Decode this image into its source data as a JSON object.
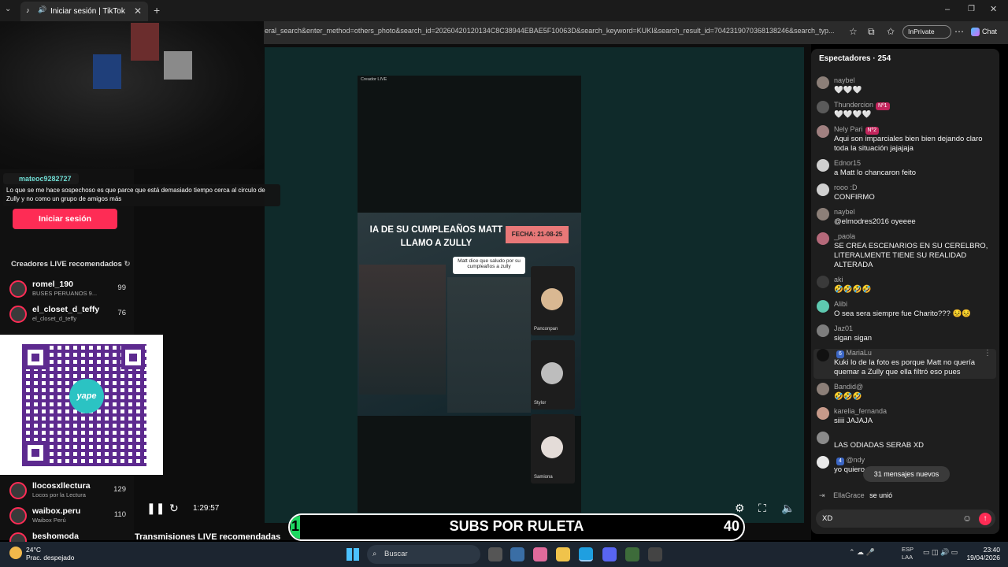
{
  "browser": {
    "tab_title": "Iniciar sesión | TikTok",
    "url": "eral_search&enter_method=others_photo&search_id=20260420120134C8C38944EBAE5F10063D&search_keyword=KUKI&search_result_id=7042319070368138246&search_typ...",
    "inprivate_label": "InPrivate",
    "chat_label": "Chat"
  },
  "left": {
    "overlay_user": "mateoc9282727",
    "overlay_message": "Lo que se me hace sospechoso es que parce que está demasiado tiempo cerca al circulo de Zully y no como un grupo de amigos más",
    "login_button": "Iniciar sesión",
    "creators_title": "Creadores LIVE recomendados",
    "creators": [
      {
        "name": "romel_190",
        "sub": "BUSES PERUANOS 9...",
        "count": "99"
      },
      {
        "name": "el_closet_d_teffy",
        "sub": "el_closet_d_teffy",
        "count": "76"
      },
      {
        "name": "llocosxllectura",
        "sub": "Locos por la Lectura",
        "count": "129"
      },
      {
        "name": "waibox.peru",
        "sub": "Waibox Perú",
        "count": "110"
      },
      {
        "name": "beshomoda",
        "sub": "",
        "count": ""
      }
    ],
    "qr_brand": "yape",
    "live_recos_title": "Transmisiones LIVE recomendadas"
  },
  "stream": {
    "phone_header": "Creador LIVE",
    "banner_line1": "IA DE SU CUMPLEAÑOS MATT",
    "banner_line2": "LLAMO A ZULLY",
    "date_tag": "FECHA: 21-08-25",
    "bubble_text": "Matt dice que saludo por su cumpleaños a zully",
    "guests": [
      "Panconpan",
      "Stylor",
      "Samiona"
    ],
    "time": "1:29:57",
    "subs_left": "1",
    "subs_title": "SUBS POR RULETA",
    "subs_right": "40"
  },
  "chat": {
    "header": "Espectadores · 254",
    "messages": [
      {
        "user": "naybel",
        "badge": "",
        "text": "🤍🤍🤍"
      },
      {
        "user": "Thundercion",
        "badge": "Nº1",
        "text": "🤍🤍🤍🤍"
      },
      {
        "user": "Nely Pari",
        "badge": "Nº2",
        "text": "Aqui son imparciales bien bien dejando claro toda la situación jajajaja"
      },
      {
        "user": "Ednor15",
        "badge": "",
        "text": "a Matt lo chancaron feito"
      },
      {
        "user": "rooo :D",
        "badge": "",
        "text": "CONFIRMO"
      },
      {
        "user": "naybel",
        "badge": "",
        "text": "@elmodres2016 oyeeee"
      },
      {
        "user": "_paola",
        "badge": "",
        "text": "SE CREA ESCENARIOS EN SU CERELBRO, LITERALMENTE TIENE SU REALIDAD ALTERADA"
      },
      {
        "user": "aki",
        "badge": "",
        "text": "🤣🤣🤣🤣"
      },
      {
        "user": "Alibi",
        "badge": "",
        "text": "O sea sera siempre fue Charito??? 😣😣"
      },
      {
        "user": "Jaz01",
        "badge": "",
        "text": "sigan sigan"
      },
      {
        "user": "MariaLu",
        "badge": "6",
        "text": "Kuki lo de la foto es porque Matt no quería quemar a Zully que ella filtró eso pues"
      },
      {
        "user": "Bandid@",
        "badge": "",
        "text": "🤣🤣🤣"
      },
      {
        "user": "karelia_fernanda",
        "badge": "",
        "text": "siiii JAJAJA"
      },
      {
        "user": "",
        "badge": "",
        "text": "LAS ODIADAS SERAB XD"
      },
      {
        "user": "@ndy",
        "badge": "4",
        "text": "yo quiero"
      }
    ],
    "new_messages": "31 mensajes nuevos",
    "join_user": "EllaGrace",
    "join_text": "se unió",
    "input_value": "XD"
  },
  "taskbar": {
    "temp": "24°C",
    "weather": "Prac. despejado",
    "search_label": "Buscar",
    "lang1": "ESP",
    "lang2": "LAA",
    "time": "23:40",
    "date": "19/04/2026"
  }
}
